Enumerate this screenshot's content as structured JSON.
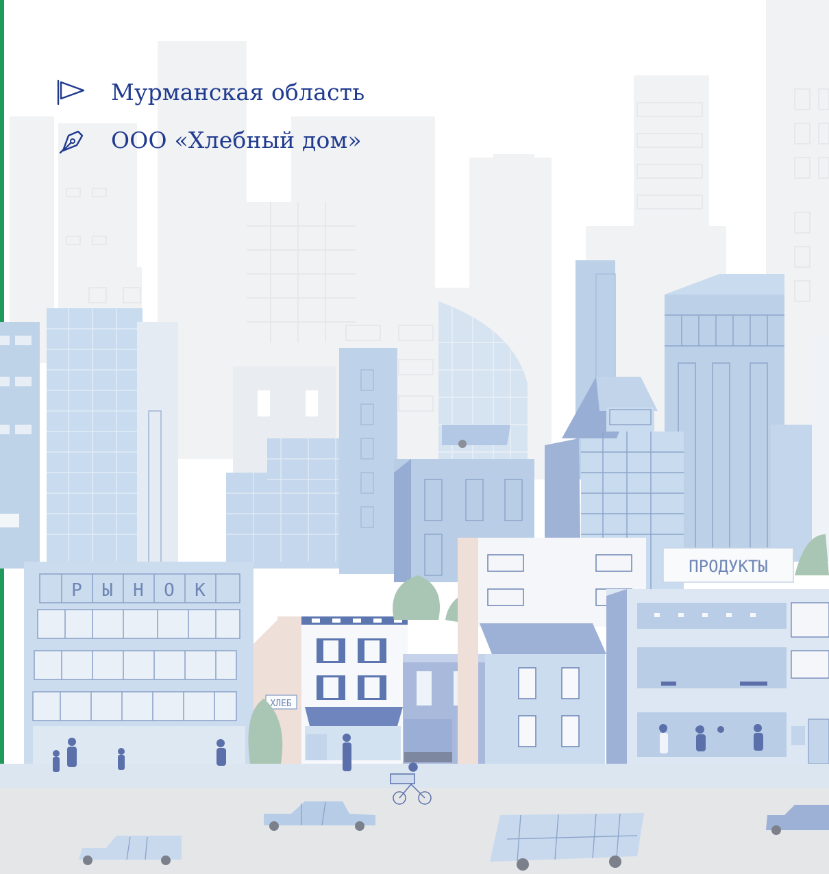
{
  "header": {
    "region_label": "Мурманская область",
    "company_label": "ООО «Хлебный дом»",
    "region_icon": "flag-icon",
    "company_icon": "pen-nib-icon"
  },
  "illustration": {
    "market_sign": [
      "Р",
      "Ы",
      "Н",
      "О",
      "К"
    ],
    "bread_sign": "ХЛЕБ",
    "products_sign": "ПРОДУКТЫ"
  },
  "colors": {
    "accent_bar": "#1f9a5b",
    "text_primary": "#1f3a8f"
  }
}
